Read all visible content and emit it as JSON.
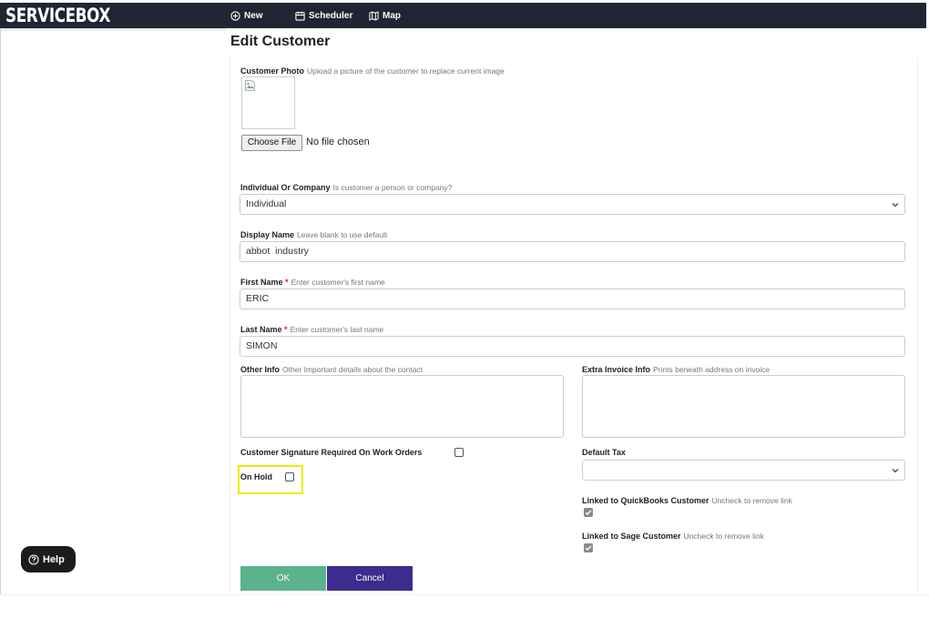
{
  "app": {
    "logo": "SERVICEBOX"
  },
  "nav": {
    "new": "New",
    "scheduler": "Scheduler",
    "map": "Map"
  },
  "page": {
    "title": "Edit Customer"
  },
  "photo": {
    "label": "Customer Photo",
    "hint": "Upload a picture of the customer to replace current image",
    "choose_button": "Choose File",
    "file_status": "No file chosen"
  },
  "individual_company": {
    "label": "Individual Or Company",
    "hint": "Is customer a person or company?",
    "value": "Individual"
  },
  "display_name": {
    "label": "Display Name",
    "hint": "Leave blank to use default",
    "value": "abbot  industry"
  },
  "first_name": {
    "label": "First Name",
    "required": "*",
    "hint": "Enter customer's first name",
    "value": "ERIC"
  },
  "last_name": {
    "label": "Last Name",
    "required": "*",
    "hint": "Enter customer's last name",
    "value": "SIMON"
  },
  "other_info": {
    "label": "Other Info",
    "hint": "Other Important details about the contact"
  },
  "extra_invoice": {
    "label": "Extra Invoice Info",
    "hint": "Prints beneath address on invoice"
  },
  "signature": {
    "label": "Customer Signature Required On Work Orders",
    "checked": false
  },
  "on_hold": {
    "label": "On Hold",
    "checked": false
  },
  "default_tax": {
    "label": "Default Tax",
    "value": ""
  },
  "quickbooks": {
    "label": "Linked to QuickBooks Customer",
    "hint": "Uncheck to remove link",
    "checked": true
  },
  "sage": {
    "label": "Linked to Sage Customer",
    "hint": "Uncheck to remove link",
    "checked": true
  },
  "buttons": {
    "ok": "OK",
    "cancel": "Cancel"
  },
  "help": {
    "label": "Help"
  },
  "colors": {
    "topbar": "#1f2533",
    "ok": "#5bb38d",
    "cancel": "#3d2b8e",
    "highlight": "#e6ee00",
    "required": "#e02020"
  }
}
